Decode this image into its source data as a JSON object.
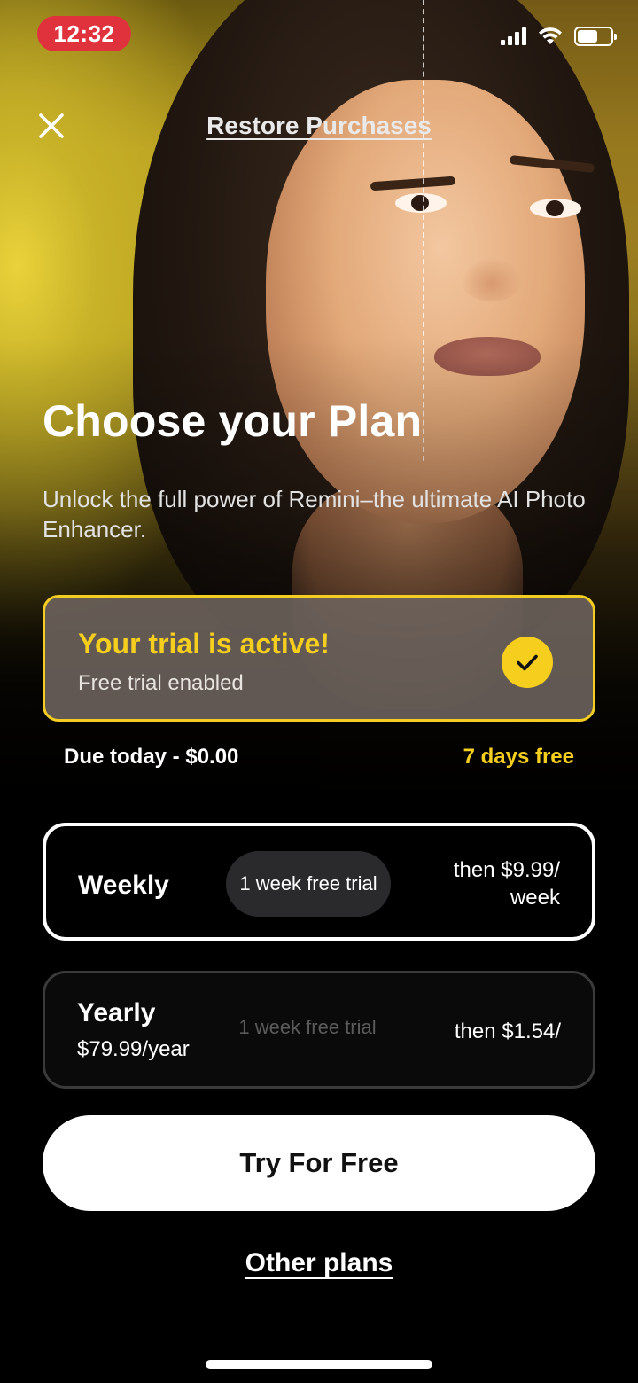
{
  "status_bar": {
    "time": "12:32",
    "signal_icon": "cellular-signal-icon",
    "wifi_icon": "wifi-icon",
    "battery_icon": "battery-icon"
  },
  "header": {
    "close_icon": "close-icon",
    "restore_label": "Restore Purchases"
  },
  "hero": {
    "title": "Choose your Plan",
    "subtitle": "Unlock the full power of Remini–the ultimate AI Photo Enhancer."
  },
  "trial": {
    "title": "Your trial is active!",
    "subtitle": "Free trial enabled",
    "check_icon": "checkmark-icon"
  },
  "due": {
    "left": "Due today - $0.00",
    "right": "7 days free"
  },
  "plans": [
    {
      "name": "Weekly",
      "price_line": "",
      "badge": "1 week free trial",
      "then": "then $9.99/ week",
      "selected": true
    },
    {
      "name": "Yearly",
      "price_line": "$79.99/year",
      "badge": "1 week free trial",
      "then": "then $1.54/",
      "selected": false
    }
  ],
  "cta": {
    "label": "Try For Free"
  },
  "footer": {
    "other_plans_label": "Other plans"
  },
  "colors": {
    "accent": "#f6cf1e",
    "status_time_bg": "#e0323c",
    "background": "#000000",
    "cta_bg": "#ffffff"
  }
}
